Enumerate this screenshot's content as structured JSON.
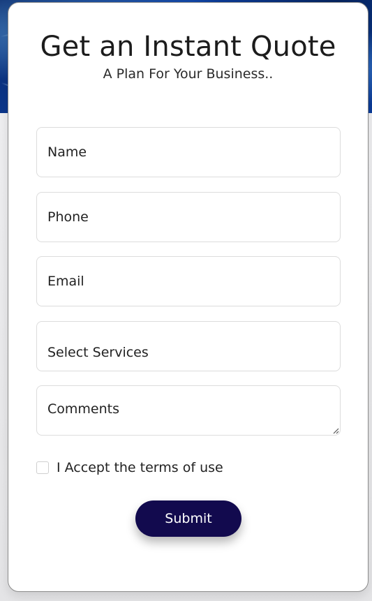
{
  "form": {
    "title": "Get an Instant Quote",
    "subtitle": "A Plan For Your Business..",
    "fields": {
      "name_placeholder": "Name",
      "phone_placeholder": "Phone",
      "email_placeholder": "Email",
      "services_value": "Select Services",
      "comments_placeholder": "Comments"
    },
    "terms_label": "I Accept the terms of use",
    "terms_checked": false,
    "submit_label": "Submit"
  },
  "colors": {
    "submit_background": "#120a4e",
    "card_background": "#ffffff",
    "field_border": "#dcdcdc",
    "hero_background": "#0d3fa0"
  },
  "icons": {
    "resize_handle": "resize-grip-icon"
  }
}
